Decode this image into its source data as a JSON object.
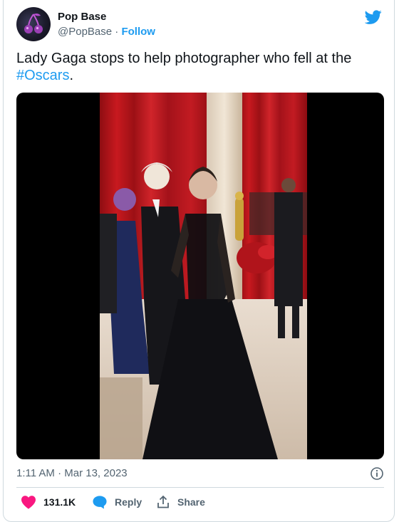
{
  "author": {
    "display_name": "Pop Base",
    "handle": "@PopBase",
    "separator": "·",
    "follow_label": "Follow"
  },
  "tweet": {
    "text": "Lady Gaga stops to help photographer who fell at the ",
    "hashtag": "#Oscars",
    "text_end": ".",
    "timestamp": "1:11 AM · Mar 13, 2023"
  },
  "media": {
    "type": "video"
  },
  "actions": {
    "like_count": "131.1K",
    "reply_label": "Reply",
    "share_label": "Share"
  },
  "colors": {
    "accent": "#1d9bf0",
    "like": "#f91880",
    "text": "#0f1419",
    "secondary": "#536471"
  },
  "icons": {
    "platform": "twitter-bird-icon",
    "like": "heart-icon",
    "reply": "speech-bubble-icon",
    "share": "share-upload-icon",
    "info": "info-icon"
  }
}
